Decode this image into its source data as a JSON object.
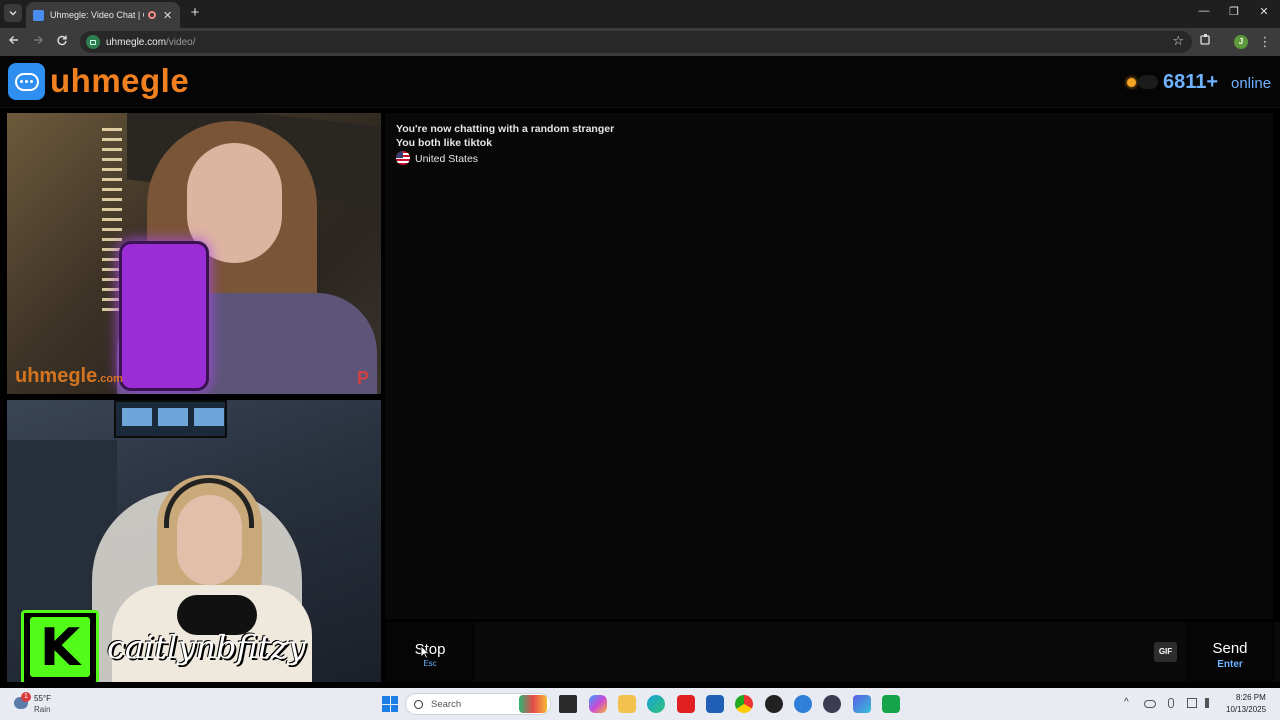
{
  "browser": {
    "tab_title": "Uhmegle: Video Chat | Omegle",
    "url_host": "uhmegle.com",
    "url_path": "/video/",
    "new_tab_symbol": "+",
    "close_symbol": "✕",
    "minimize_symbol": "—",
    "restore_symbol": "❐",
    "window_close_symbol": "✕",
    "profile_initial": "J"
  },
  "site": {
    "logo_text": "uhmegle",
    "online_count": "6811+",
    "online_label": "online"
  },
  "videos": {
    "stranger_watermark": "uhmegle",
    "stranger_watermark_suffix": ".com",
    "stranger_badge": "P",
    "self_overlay_logo": "K",
    "self_overlay_name": "caitlynbfitzy"
  },
  "chat": {
    "status_line": "You're now chatting with a random stranger",
    "interest_line": "You both like tiktok",
    "country": "United States"
  },
  "controls": {
    "stop_label": "Stop",
    "stop_hint": "Esc",
    "gif_label": "GIF",
    "send_label": "Send",
    "send_hint": "Enter"
  },
  "taskbar": {
    "weather_temp": "55°F",
    "weather_desc": "Rain",
    "weather_badge": "1",
    "search_placeholder": "Search",
    "time": "8:26 PM",
    "date": "10/13/2025"
  },
  "colors": {
    "brand_orange": "#f08020",
    "brand_blue": "#2f8ff0",
    "online_blue": "#6fb2ff",
    "kick_green": "#53fc18"
  }
}
